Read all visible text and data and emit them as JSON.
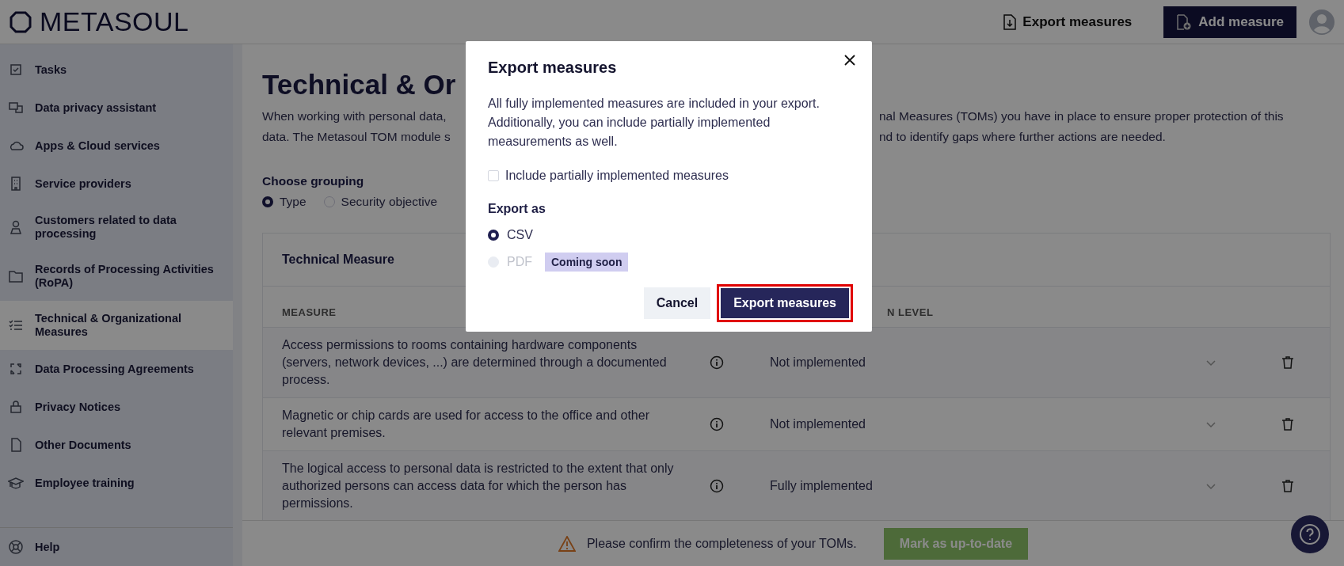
{
  "brand": {
    "name": "METASOUL"
  },
  "header": {
    "actions": [
      {
        "kind": "link",
        "label": "Export measures"
      },
      {
        "kind": "primary",
        "label": "Add measure"
      }
    ]
  },
  "sidebar": {
    "items": [
      {
        "label": "Tasks",
        "selected": false
      },
      {
        "label": "Data privacy assistant",
        "selected": false
      },
      {
        "label": "Apps & Cloud services",
        "selected": false
      },
      {
        "label": "Service providers",
        "selected": false
      },
      {
        "label": "Customers related to data processing",
        "selected": false
      },
      {
        "label": "Records of Processing Activities (RoPA)",
        "selected": false
      },
      {
        "label": "Technical & Organizational Measures",
        "selected": true
      },
      {
        "label": "Data Processing Agreements",
        "selected": false
      },
      {
        "label": "Privacy Notices",
        "selected": false
      },
      {
        "label": "Other Documents",
        "selected": false
      },
      {
        "label": "Employee training",
        "selected": false
      }
    ],
    "footer_items": [
      {
        "label": "Help"
      }
    ]
  },
  "page": {
    "title": "Technical & Or",
    "description": {
      "left_lines": [
        "When working with personal data,",
        "data. The Metasoul TOM module s"
      ],
      "right_lines": [
        "nal Measures (TOMs) you have in place to ensure proper protection of this",
        "nd to identify gaps where further actions are needed."
      ]
    },
    "grouping": {
      "label": "Choose grouping",
      "options": [
        {
          "label": "Type",
          "selected": true
        },
        {
          "label": "Security objective",
          "selected": false
        }
      ]
    }
  },
  "table": {
    "title": "Technical Measure",
    "columns": [
      "MEASURE",
      "N LEVEL"
    ],
    "rows": [
      {
        "measure": "Access permissions to rooms containing hardware components (servers, network devices, ...) are determined through a documented process.",
        "level": "Not implemented"
      },
      {
        "measure": "Magnetic or chip cards are used for access to the office and other relevant premises.",
        "level": "Not implemented"
      },
      {
        "measure": "The logical access to personal data is restricted to the extent that only authorized persons can access data for which the person has permissions.",
        "level": "Fully implemented"
      }
    ]
  },
  "bottom_bar": {
    "message": "Please confirm the completeness of your TOMs.",
    "button": "Mark as up-to-date"
  },
  "modal": {
    "title": "Export measures",
    "text": "All fully implemented measures are included in your export. Additionally, you can include partially implemented measurements as well.",
    "checkbox": {
      "label": "Include partially implemented measures",
      "checked": false
    },
    "export_as": {
      "label": "Export as",
      "options": [
        {
          "label": "CSV",
          "selected": true,
          "disabled": false
        },
        {
          "label": "PDF",
          "selected": false,
          "disabled": true,
          "badge": "Coming soon"
        }
      ]
    },
    "buttons": [
      {
        "kind": "secondary",
        "label": "Cancel",
        "highlighted": false
      },
      {
        "kind": "primary",
        "label": "Export measures",
        "highlighted": true
      }
    ]
  }
}
